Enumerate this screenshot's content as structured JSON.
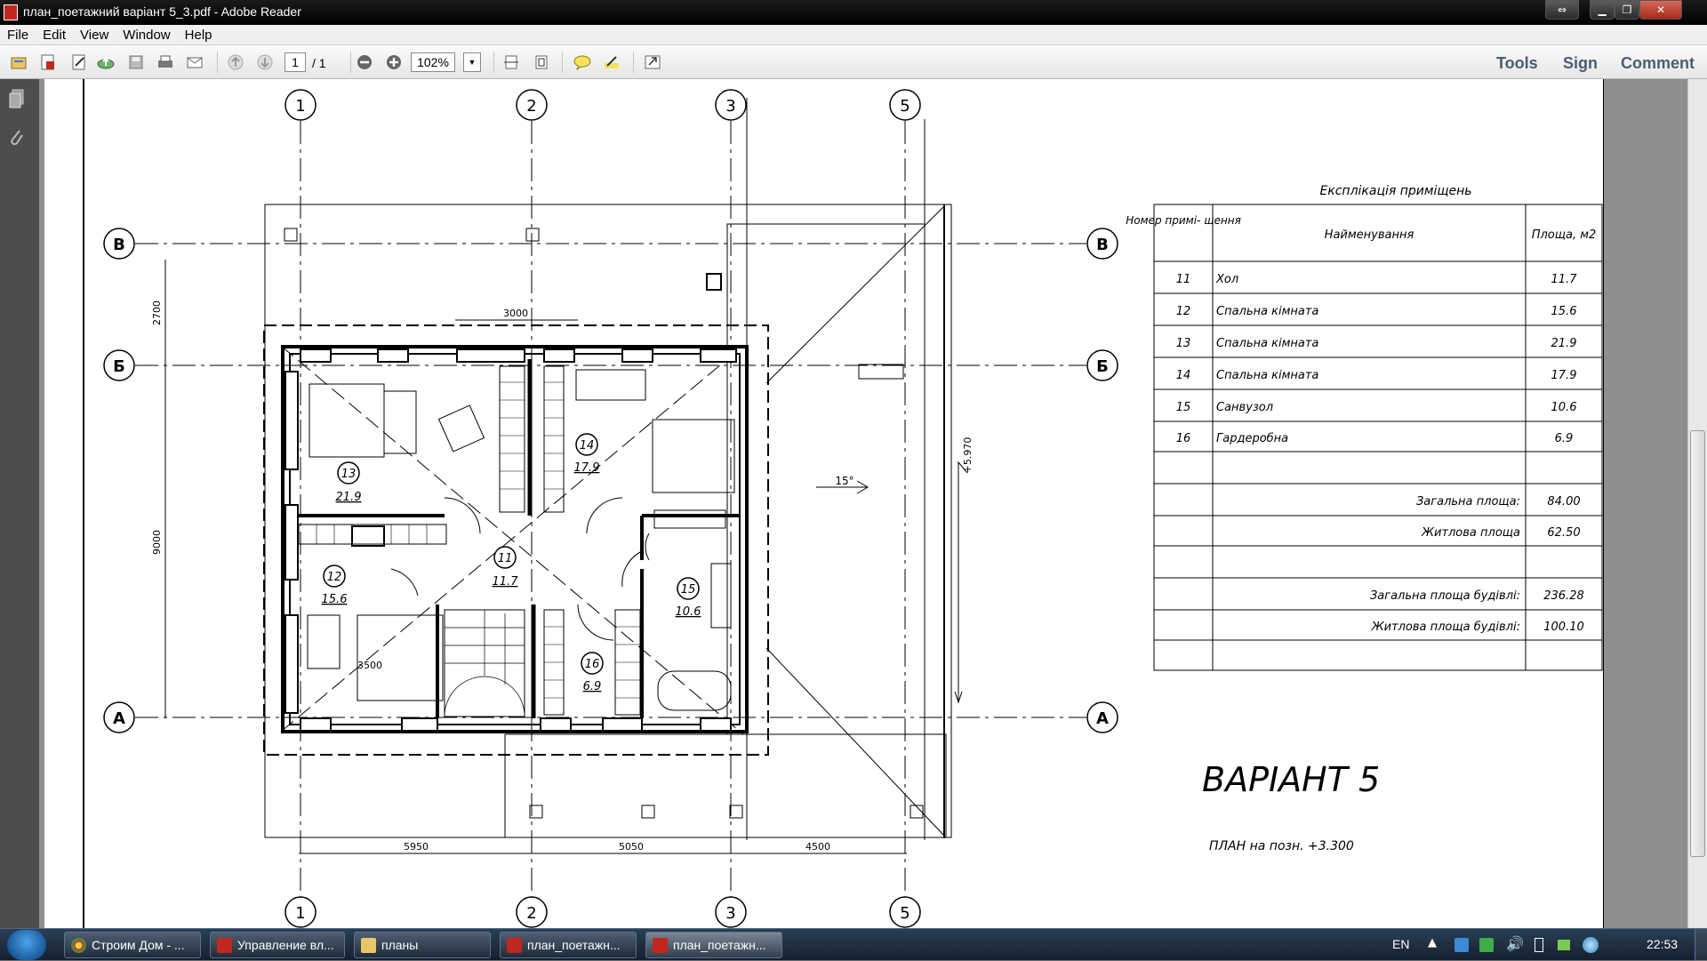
{
  "window": {
    "title": "план_поетажний варіант 5_3.pdf - Adobe Reader"
  },
  "menu": [
    "File",
    "Edit",
    "View",
    "Window",
    "Help"
  ],
  "toolbar": {
    "page_current": "1",
    "page_total": "/ 1",
    "zoom": "102%",
    "right_links": [
      "Tools",
      "Sign",
      "Comment"
    ]
  },
  "drawing": {
    "axes_top": [
      "1",
      "2",
      "3",
      "5"
    ],
    "axes_side": [
      "В",
      "Б",
      "А"
    ],
    "dimensions": {
      "d3000": "3000",
      "d2700": "2700",
      "d9000": "9000",
      "d3500": "3500",
      "d5950": "5950",
      "d5050": "5050",
      "d4500": "4500",
      "elev": "+5.970",
      "slope": "15°"
    },
    "rooms": [
      {
        "num": "13",
        "area": "21.9"
      },
      {
        "num": "14",
        "area": "17.9"
      },
      {
        "num": "11",
        "area": "11.7"
      },
      {
        "num": "12",
        "area": "15.6"
      },
      {
        "num": "15",
        "area": "10.6"
      },
      {
        "num": "16",
        "area": "6.9"
      }
    ],
    "variant_title": "ВАРІАНТ 5",
    "plan_label": "ПЛАН на позн. +3.300"
  },
  "explication": {
    "title": "Експлікація приміщень",
    "headers": [
      "Номер примі- щення",
      "Найменування",
      "Площа, м2"
    ],
    "rows": [
      [
        "11",
        "Хол",
        "11.7"
      ],
      [
        "12",
        "Спальна кімната",
        "15.6"
      ],
      [
        "13",
        "Спальна кімната",
        "21.9"
      ],
      [
        "14",
        "Спальна кімната",
        "17.9"
      ],
      [
        "15",
        "Санвузол",
        "10.6"
      ],
      [
        "16",
        "Гардеробна",
        "6.9"
      ]
    ],
    "totals": [
      [
        "Загальна площа:",
        "84.00"
      ],
      [
        "Житлова площа",
        "62.50"
      ],
      [
        "Загальна площа будівлі:",
        "236.28"
      ],
      [
        "Житлова площа будівлі:",
        "100.10"
      ]
    ]
  },
  "taskbar": {
    "tasks": [
      "Строим Дом - ...",
      "Управление вл...",
      "планы",
      "план_поетажн...",
      "план_поетажн..."
    ],
    "lang": "EN",
    "clock": "22:53"
  }
}
